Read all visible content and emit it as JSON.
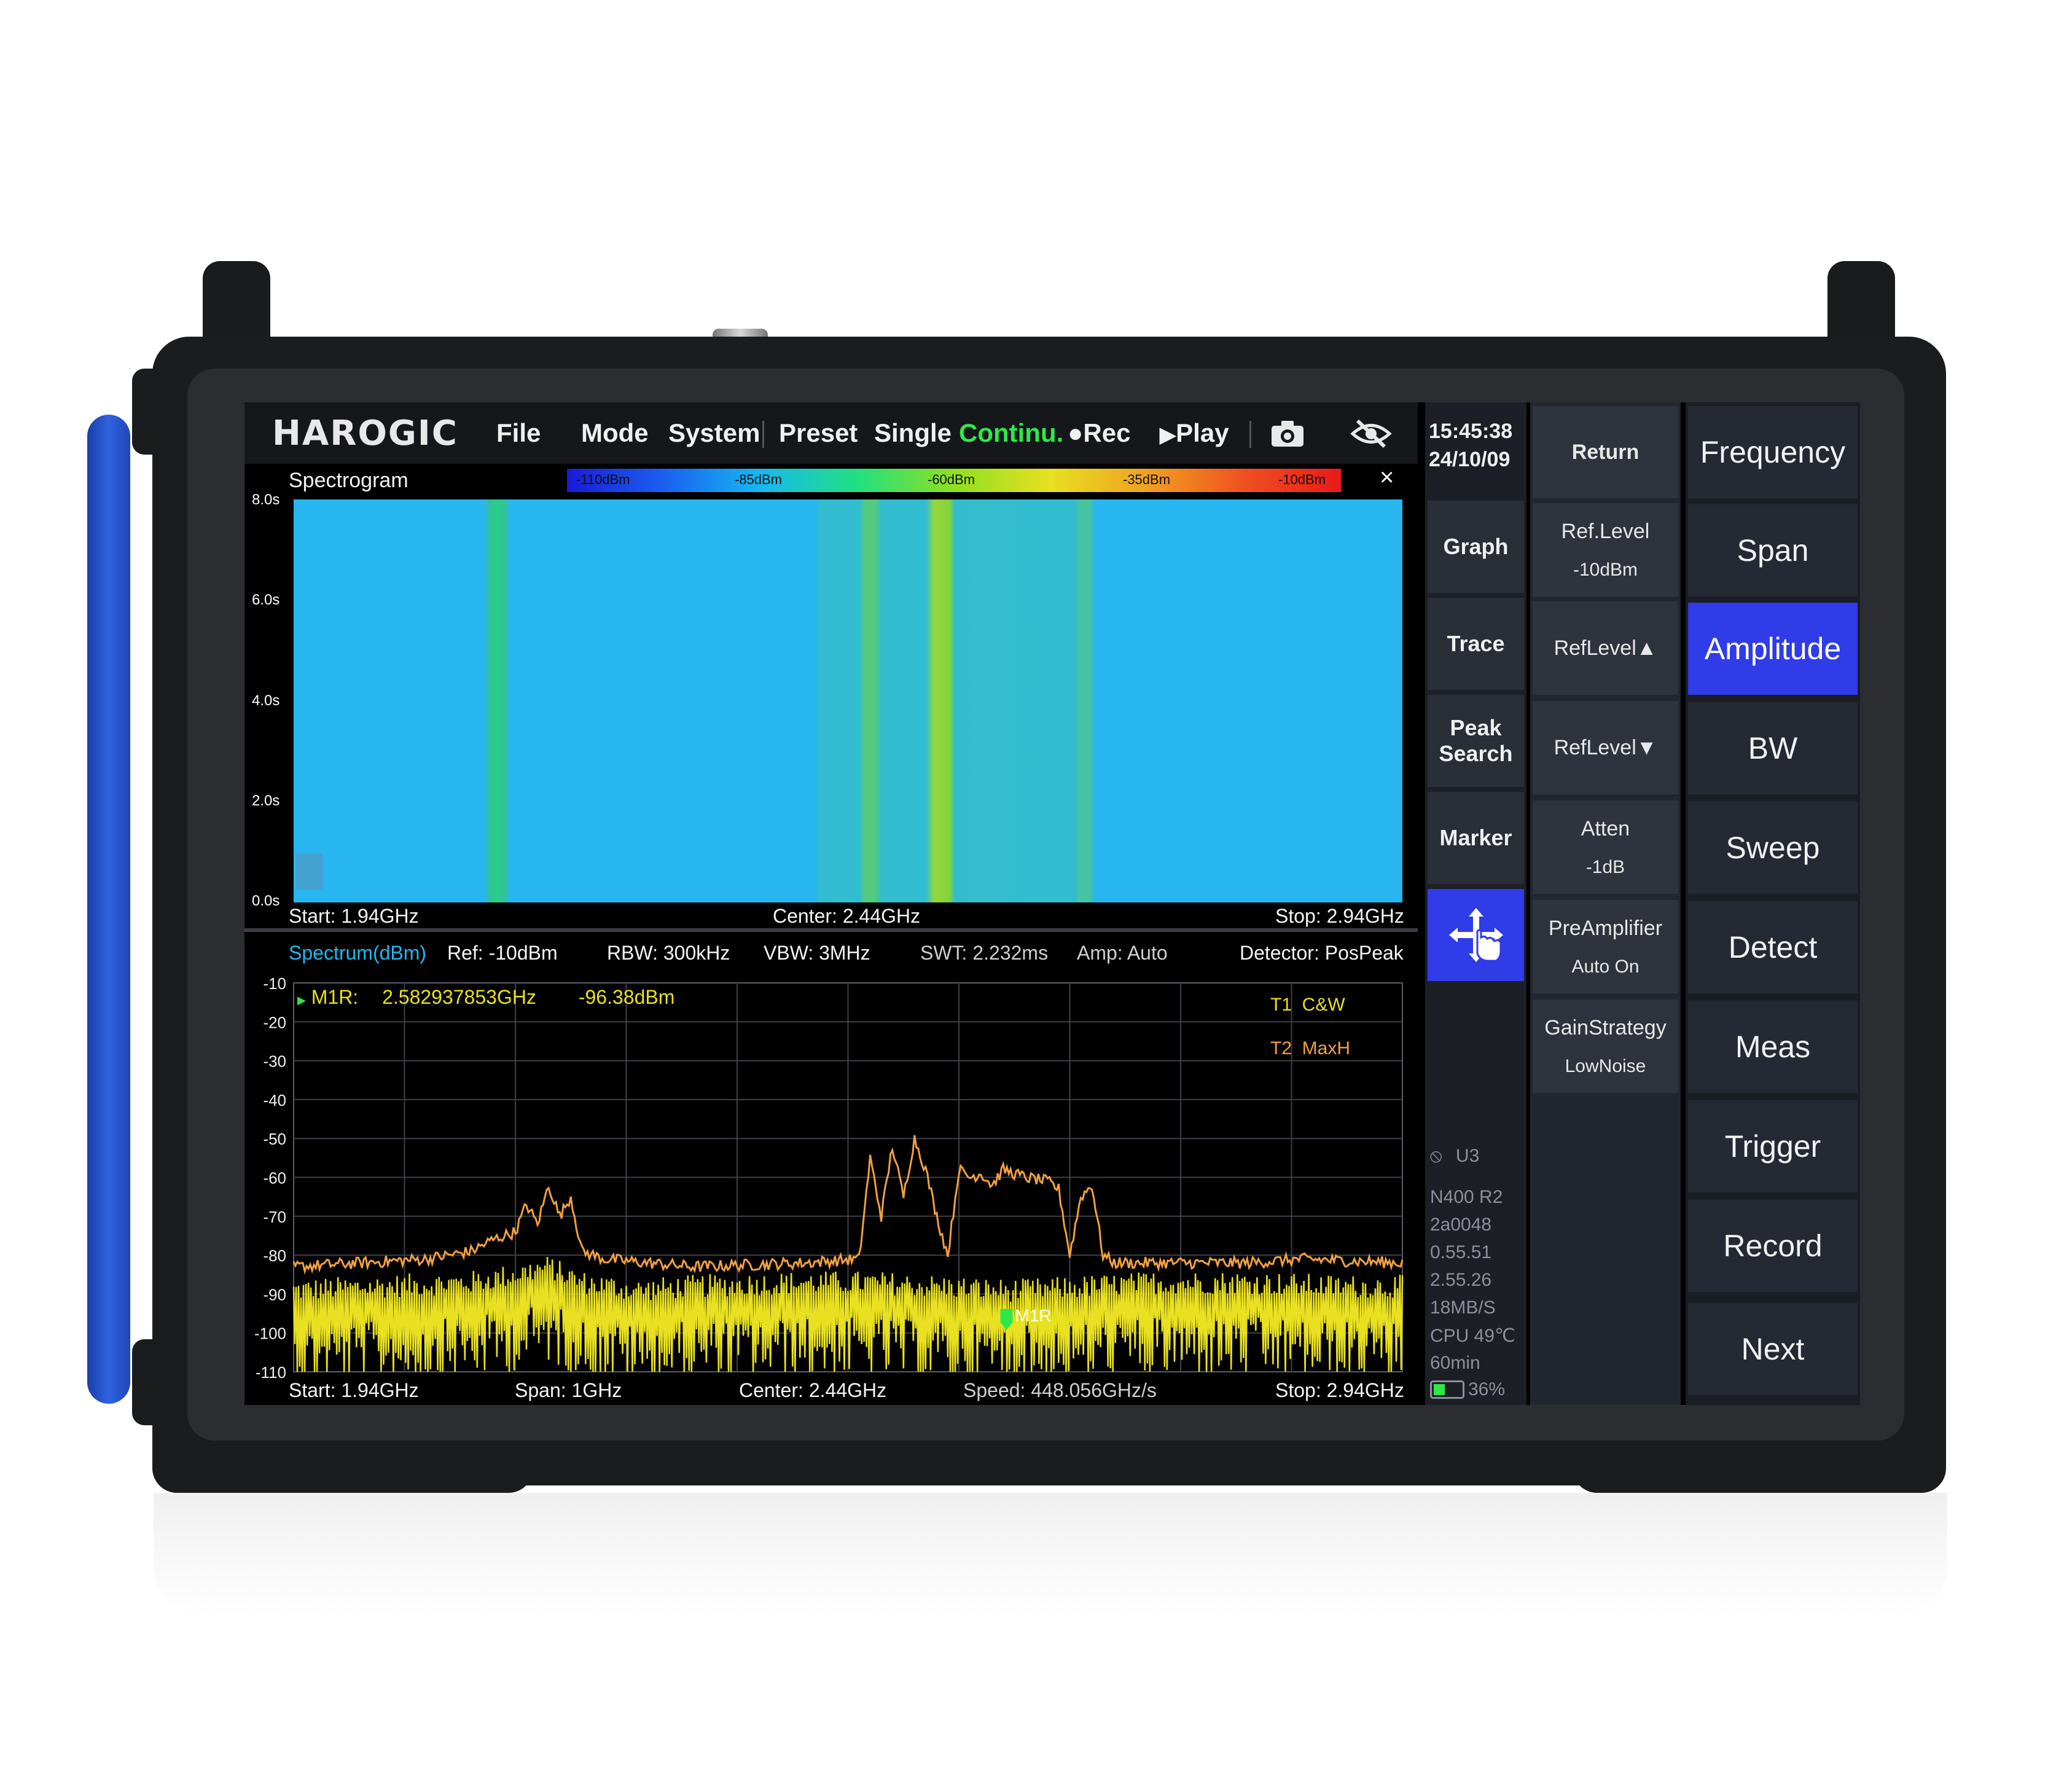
{
  "app": {
    "logo": "HAROGIC"
  },
  "menu": [
    {
      "label": "File"
    },
    {
      "label": "Mode"
    },
    {
      "label": "System"
    },
    {
      "label": "Preset"
    },
    {
      "label": "Single"
    },
    {
      "label": "Continu.",
      "color": "#2ee84a"
    },
    {
      "label": "Rec"
    },
    {
      "label": "Play"
    }
  ],
  "icons": {
    "camera": "camera-icon",
    "hide": "eye-slash-icon",
    "move": "move-hand-icon"
  },
  "clock": {
    "time": "15:45:38",
    "date": "24/10/09"
  },
  "spectrogram": {
    "title": "Spectrogram",
    "colorbar": [
      "-110dBm",
      "-85dBm",
      "-60dBm",
      "-35dBm",
      "-10dBm"
    ],
    "y_ticks": [
      "8.0s",
      "6.0s",
      "4.0s",
      "2.0s",
      "0.0s"
    ],
    "start": "Start: 1.94GHz",
    "center": "Center: 2.44GHz",
    "stop": "Stop: 2.94GHz",
    "close": "×"
  },
  "spectrum": {
    "title": "Spectrum(dBm)",
    "ref": "Ref: -10dBm",
    "rbw": "RBW: 300kHz",
    "vbw": "VBW: 3MHz",
    "swt": "SWT: 2.232ms",
    "amp": "Amp: Auto",
    "detector": "Detector: PosPeak",
    "marker_label": "M1R:",
    "marker_freq": "2.582937853GHz",
    "marker_level": "-96.38dBm",
    "marker_tag": "M1R",
    "t1": "T1  C&W",
    "t2": "T2  MaxH",
    "start": "Start: 1.94GHz",
    "span": "Span: 1GHz",
    "center": "Center: 2.44GHz",
    "speed": "Speed: 448.056GHz/s",
    "stop": "Stop: 2.94GHz"
  },
  "chart_data": {
    "type": "line",
    "x_unit": "GHz",
    "xlim": [
      1.94,
      2.94
    ],
    "ylim": [
      -110,
      -10
    ],
    "yticks": [
      -10,
      -20,
      -30,
      -40,
      -50,
      -60,
      -70,
      -80,
      -90,
      -100,
      -110
    ],
    "series": [
      {
        "name": "T1  C&W",
        "color": "#e8e020",
        "x": [
          1.94,
          2.02,
          2.1,
          2.14,
          2.17,
          2.2,
          2.25,
          2.3,
          2.4,
          2.46,
          2.52,
          2.58,
          2.6,
          2.66,
          2.72,
          2.8,
          2.88,
          2.94
        ],
        "y": [
          -92,
          -91,
          -90,
          -88,
          -86,
          -90,
          -92,
          -91,
          -90,
          -90,
          -91,
          -92,
          -92,
          -91,
          -90,
          -90,
          -91,
          -91
        ]
      },
      {
        "name": "T2  MaxH",
        "color": "#f0a040",
        "x": [
          1.94,
          2.0,
          2.06,
          2.1,
          2.12,
          2.14,
          2.15,
          2.16,
          2.17,
          2.18,
          2.19,
          2.2,
          2.22,
          2.3,
          2.4,
          2.45,
          2.46,
          2.47,
          2.48,
          2.49,
          2.5,
          2.51,
          2.52,
          2.53,
          2.54,
          2.55,
          2.56,
          2.57,
          2.58,
          2.6,
          2.62,
          2.63,
          2.64,
          2.65,
          2.66,
          2.67,
          2.68,
          2.69,
          2.7,
          2.75,
          2.8,
          2.85,
          2.94
        ],
        "y": [
          -83,
          -82,
          -81,
          -79,
          -76,
          -74,
          -67,
          -72,
          -62,
          -70,
          -65,
          -79,
          -81,
          -83,
          -82,
          -81,
          -55,
          -70,
          -52,
          -65,
          -50,
          -58,
          -70,
          -80,
          -58,
          -60,
          -59,
          -62,
          -58,
          -60,
          -61,
          -63,
          -80,
          -65,
          -62,
          -80,
          -82,
          -82,
          -82,
          -82,
          -82,
          -81,
          -82
        ]
      }
    ],
    "marker": {
      "name": "M1R",
      "x": 2.582937853,
      "y": -96.38
    }
  },
  "side_a": [
    {
      "label": "Graph"
    },
    {
      "label": "Trace"
    },
    {
      "label": "Peak Search"
    },
    {
      "label": "Marker"
    }
  ],
  "side_b": [
    {
      "label": "Return",
      "sub": ""
    },
    {
      "label": "Ref.Level",
      "sub": "-10dBm"
    },
    {
      "label": "RefLevel▲",
      "sub": ""
    },
    {
      "label": "RefLevel▼",
      "sub": ""
    },
    {
      "label": "Atten",
      "sub": "-1dB"
    },
    {
      "label": "PreAmplifier",
      "sub": "Auto On"
    },
    {
      "label": "GainStrategy",
      "sub": "LowNoise"
    }
  ],
  "side_c": [
    {
      "label": "Frequency",
      "active": false
    },
    {
      "label": "Span",
      "active": false
    },
    {
      "label": "Amplitude",
      "active": true
    },
    {
      "label": "BW",
      "active": false
    },
    {
      "label": "Sweep",
      "active": false
    },
    {
      "label": "Detect",
      "active": false
    },
    {
      "label": "Meas",
      "active": false
    },
    {
      "label": "Trigger",
      "active": false
    },
    {
      "label": "Record",
      "active": false
    },
    {
      "label": "Next",
      "active": false
    }
  ],
  "status": {
    "u3": "U3",
    "lines": [
      "N400 R2",
      "2a0048",
      "0.55.51",
      "2.55.26",
      "18MB/S",
      "CPU 49℃",
      "60min"
    ],
    "battery": "36%"
  },
  "colors": {
    "accent": "#2f3ce8",
    "spectrum_title": "#1eb8f0",
    "marker": "#e8e020"
  }
}
